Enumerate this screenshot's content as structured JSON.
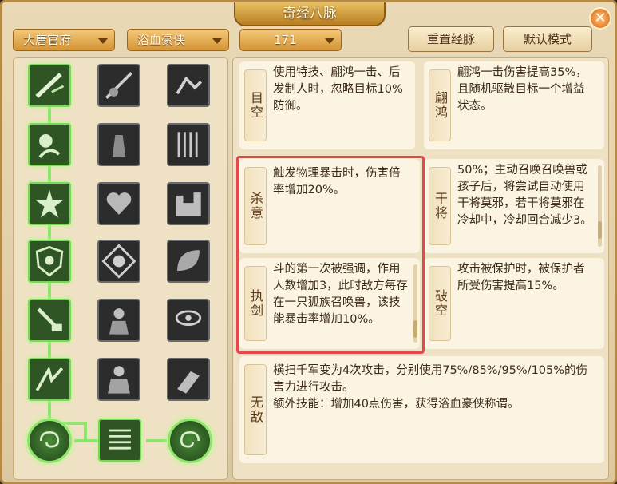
{
  "window": {
    "title": "奇经八脉",
    "close": "✕"
  },
  "toolbar": {
    "faction": "大唐官府",
    "school": "浴血豪侠",
    "points": "171",
    "reset_label": "重置经脉",
    "default_label": "默认模式"
  },
  "colors": {
    "active_border": "#76d957",
    "highlight": "#e5474f",
    "accent": "#d49435"
  },
  "tree": {
    "rows": [
      [
        "sword-slash-icon",
        "spear-fall-icon",
        "charge-boot-icon"
      ],
      [
        "warrior-roar-icon",
        "stone-figure-icon",
        "sword-rack-icon"
      ],
      [
        "burst-strike-icon",
        "heart-hands-icon",
        "fortress-wall-icon"
      ],
      [
        "shield-heart-icon",
        "brave-seal-icon",
        "leaf-shield-icon"
      ],
      [
        "sword-grip-icon",
        "guardian-figure-icon",
        "evil-eye-icon"
      ],
      [
        "rage-slash-icon",
        "armored-general-icon",
        "war-horn-icon"
      ]
    ],
    "bottom": [
      "left-swirl-icon",
      "stacked-blades-icon",
      "right-swirl-icon"
    ]
  },
  "cards": {
    "mukong": {
      "label": "目空",
      "text": "使用特技、翩鸿一击、后发制人时，忽略目标10%防御。"
    },
    "pianhong": {
      "label": "翩鸿",
      "text": "翩鸿一击伤害提高35%，且随机驱散目标一个增益状态。"
    },
    "shayi": {
      "label": "杀意",
      "text": "触发物理暴击时，伤害倍率增加20%。"
    },
    "ganjiang": {
      "label": "干将",
      "text": "50%；主动召唤召唤兽或孩子后，将尝试自动使用干将莫邪，若干将莫邪在冷却中，冷却回合减少3。"
    },
    "zhijian": {
      "label": "执剑",
      "text": "斗的第一次被强调，作用人数增加3，此时敌方每存在一只狐族召唤兽，该技能暴击率增加10%。"
    },
    "pokong": {
      "label": "破空",
      "text": "攻击被保护时，被保护者所受伤害提高15%。"
    },
    "wudi": {
      "label": "无敌",
      "line1": "横扫千军变为4次攻击，分别使用75%/85%/95%/105%的伤害力进行攻击。",
      "line2": "额外技能：增加40点伤害，获得浴血豪侠称谓。"
    }
  }
}
